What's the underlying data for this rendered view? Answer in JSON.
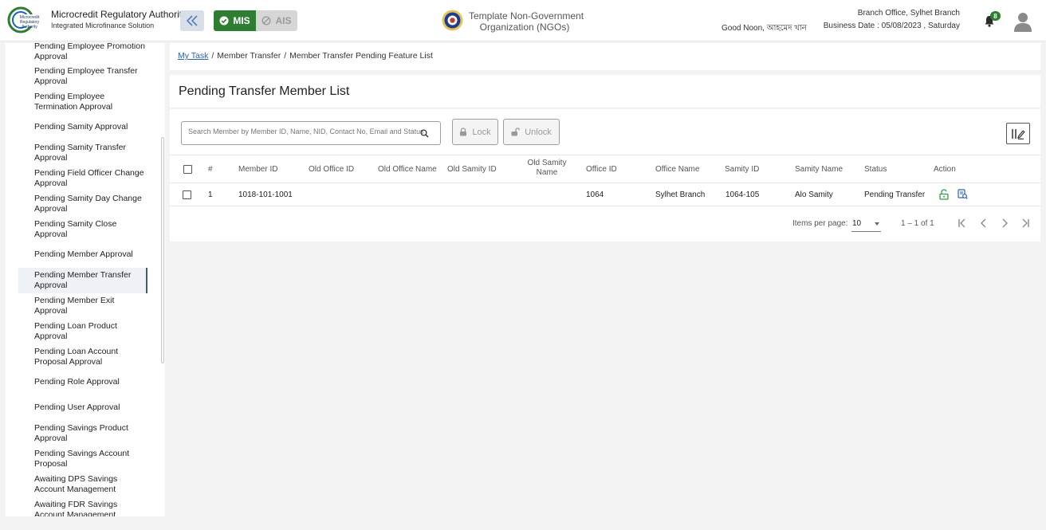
{
  "header": {
    "logo_text": "Microcredit Regulatory Authority",
    "brand_title": "Microcredit Regulatory Authority",
    "brand_subtitle": "Integrated Microfinance Solution",
    "mis_label": "MIS",
    "ais_label": "AIS",
    "ngo_line1": "Template Non-Government",
    "ngo_line2": "Organization (NGOs)",
    "greeting": "Good Noon, আহমেদ খান",
    "branch_office": "Branch Office, Sylhet Branch",
    "business_date": "Business Date : 05/08/2023 , Saturday",
    "notification_count": "8",
    "colors": {
      "mis": "#2e7d32",
      "badge": "#2e7d32"
    }
  },
  "sidebar": {
    "items": [
      {
        "label": "Pending Employee Promotion Approval"
      },
      {
        "label": "Pending Employee Transfer Approval"
      },
      {
        "label": "Pending Employee Termination Approval"
      },
      {
        "label": "Pending Samity Approval"
      },
      {
        "label": "Pending Samity Transfer Approval"
      },
      {
        "label": "Pending Field Officer Change Approval"
      },
      {
        "label": "Pending Samity Day Change Approval"
      },
      {
        "label": "Pending Samity Close Approval"
      },
      {
        "label": "Pending Member Approval"
      },
      {
        "label": "Pending Member Transfer Approval",
        "active": true
      },
      {
        "label": "Pending Member Exit Approval"
      },
      {
        "label": "Pending Loan Product Approval"
      },
      {
        "label": "Pending Loan Account Proposal Approval"
      },
      {
        "label": "Pending Role Approval"
      },
      {
        "label": "Pending User Approval"
      },
      {
        "label": "Pending Savings Product Approval"
      },
      {
        "label": "Pending Savings Account Proposal"
      },
      {
        "label": "Awaiting DPS Savings Account Management"
      },
      {
        "label": "Awaiting FDR Savings Account Management"
      }
    ]
  },
  "breadcrumb": {
    "items": [
      "My Task",
      "Member Transfer",
      "Member Transfer Pending Feature List"
    ],
    "separator": "/"
  },
  "main": {
    "title": "Pending Transfer Member List",
    "search_placeholder": "Search Member by Member ID, Name, NID, Contact No, Email and Status",
    "lock_label": "Lock",
    "unlock_label": "Unlock"
  },
  "table": {
    "headers": {
      "index": "#",
      "member_id": "Member ID",
      "old_office_id": "Old Office ID",
      "old_office_name": "Old Office Name",
      "old_samity_id": "Old Samity ID",
      "old_samity_name_1": "Old Samity",
      "old_samity_name_2": "Name",
      "office_id": "Office ID",
      "office_name": "Office Name",
      "samity_id": "Samity ID",
      "samity_name": "Samity Name",
      "status": "Status",
      "action": "Action"
    },
    "rows": [
      {
        "index": "1",
        "member_id": "1018-101-1001",
        "old_office_id": "",
        "old_office_name": "",
        "old_samity_id": "",
        "old_samity_name": "",
        "office_id": "1064",
        "office_name": "Sylhet Branch",
        "samity_id": "1064-105",
        "samity_name": "Alo Samity",
        "status": "Pending Transfer"
      }
    ]
  },
  "paginator": {
    "items_per_page_label": "Items per page:",
    "items_per_page": "10",
    "range": "1 – 1 of 1"
  }
}
